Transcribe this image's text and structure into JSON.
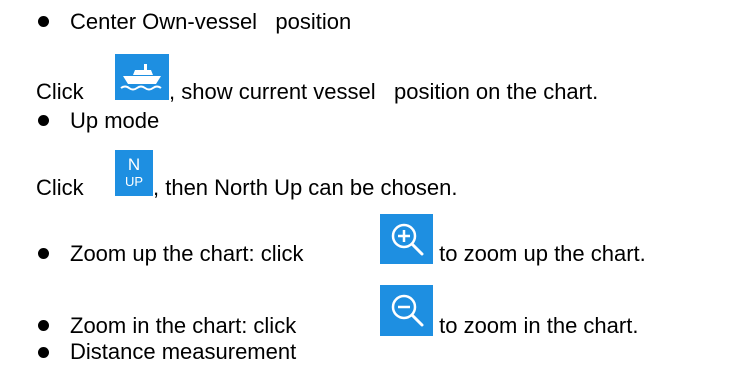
{
  "items": [
    {
      "heading": "Center Own-vessel   position",
      "line_prefix": "Click",
      "line_suffix": ", show current vessel   position on the chart.",
      "icon": "ship-icon"
    },
    {
      "heading": "Up mode",
      "line_prefix": "Click",
      "line_suffix": ", then North Up can be chosen.",
      "icon": "north-up-icon",
      "icon_label_top": "N",
      "icon_label_bottom": "UP"
    },
    {
      "prefix": "Zoom up the chart: click",
      "suffix": " to zoom up the chart.",
      "icon": "zoom-in-icon"
    },
    {
      "prefix": "Zoom in the chart: click",
      "suffix": " to zoom in the chart.",
      "icon": "zoom-out-icon"
    },
    {
      "heading": "Distance measurement"
    }
  ],
  "colors": {
    "icon_bg": "#1e8fe1",
    "icon_fg": "#ffffff"
  }
}
